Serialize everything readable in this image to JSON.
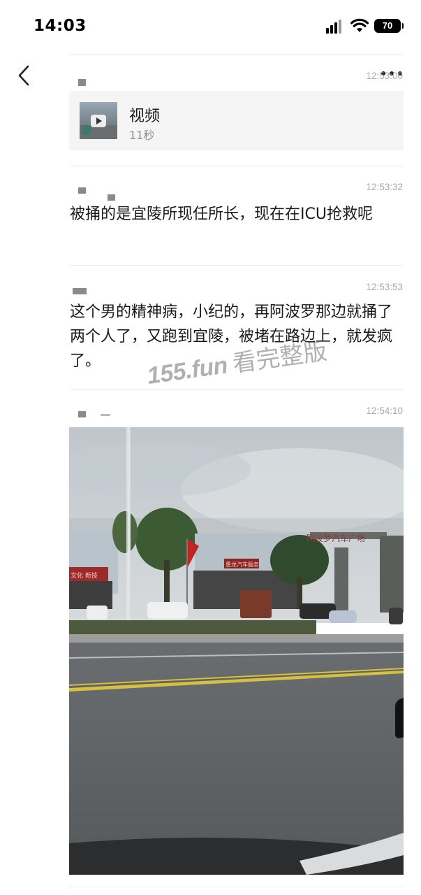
{
  "status_bar": {
    "time": "14:03",
    "battery": "70"
  },
  "messages": [
    {
      "timestamp": "12:53:00",
      "type": "video",
      "video": {
        "title": "视频",
        "duration": "11秒"
      }
    },
    {
      "timestamp": "12:53:32",
      "type": "text",
      "text": "被捅的是宜陵所现任所长，现在在ICU抢救呢"
    },
    {
      "timestamp": "12:53:53",
      "type": "text",
      "text": "这个男的精神病，小纪的，再阿波罗那边就捅了两个人了，又跑到宜陵，被堵在路边上，就发疯了。"
    },
    {
      "timestamp": "12:54:10",
      "type": "image"
    }
  ],
  "watermark": {
    "site": "155.fun",
    "cta": "看完整版"
  },
  "photo_signs": {
    "gate": "阿波罗汽车广场",
    "shop_left": "文化 新技",
    "shop_mid": "惠龙汽车服务"
  },
  "colors": {
    "timestamp": "#a9a9a9",
    "card_bg": "#f5f5f5",
    "sky": "#c9ced2",
    "road": "#5f6264"
  },
  "icons": {
    "back": "chevron-left-icon",
    "more": "more-dots-icon",
    "video": "video-camera-icon"
  }
}
